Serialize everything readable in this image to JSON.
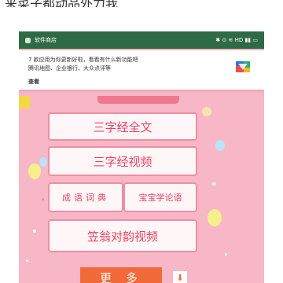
{
  "page_top_text": "来菜子都动品外力我",
  "statusbar": {
    "app_name": "软件商店",
    "indicators": "✱ ⊙ ≋ HD ▮▮ ▭"
  },
  "notification": {
    "line1": "7 款应用为你更新好啦，看看有什么新功能吧",
    "line2": "腾讯地图、企业银行、大众点评等",
    "action": "查看"
  },
  "buttons": {
    "full_text": "三字经全文",
    "video": "三字经视频",
    "idioms": "成语词典",
    "analects": "宝宝学论语",
    "rhymes": "笠翁对韵视频",
    "more": "更多",
    "download_icon": "⬇"
  },
  "colors": {
    "background": "#f7b7c7",
    "statusbar": "#2e6b45",
    "button_border": "#f08da2",
    "button_text": "#e8445f",
    "more_button": "#f06a3a"
  }
}
